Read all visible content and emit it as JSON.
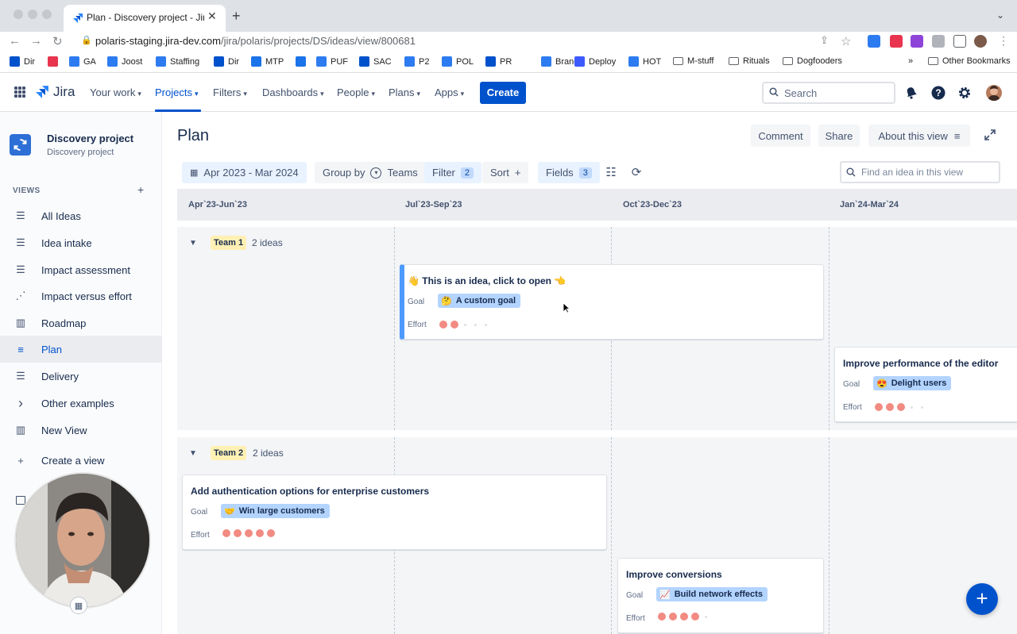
{
  "browser": {
    "tab_title": "Plan - Discovery project - Jira",
    "url_host": "polaris-staging.jira-dev.com",
    "url_path": "/jira/polaris/projects/DS/ideas/view/800681",
    "bookmarks": [
      "Dir",
      "",
      "GA",
      "Joost",
      "Staffing",
      "Dir",
      "MTP",
      "",
      "PUF",
      "SAC",
      "P2",
      "POL",
      "PR",
      "Branch",
      "Deploy",
      "HOT",
      "M-stuff",
      "Rituals",
      "Dogfooders"
    ],
    "bookmarks_more": "»",
    "other_bookmarks": "Other Bookmarks"
  },
  "topnav": {
    "logo_text": "Jira",
    "items": [
      "Your work",
      "Projects",
      "Filters",
      "Dashboards",
      "People",
      "Plans",
      "Apps"
    ],
    "create_label": "Create",
    "search_placeholder": "Search"
  },
  "sidebar": {
    "project_name": "Discovery project",
    "project_type": "Discovery project",
    "views_label": "VIEWS",
    "items": [
      {
        "label": "All Ideas",
        "icon": "list-icon"
      },
      {
        "label": "Idea intake",
        "icon": "list-icon"
      },
      {
        "label": "Impact assessment",
        "icon": "list-icon"
      },
      {
        "label": "Impact versus effort",
        "icon": "scatter-icon"
      },
      {
        "label": "Roadmap",
        "icon": "board-icon"
      },
      {
        "label": "Plan",
        "icon": "timeline-icon"
      },
      {
        "label": "Delivery",
        "icon": "list-icon"
      },
      {
        "label": "Other examples",
        "icon": "chevron-right-icon"
      },
      {
        "label": "New View",
        "icon": "board-icon"
      },
      {
        "label": "Create a view",
        "icon": "plus-icon"
      }
    ]
  },
  "main": {
    "title": "Plan",
    "header_buttons": {
      "comment": "Comment",
      "share": "Share",
      "about": "About this view"
    },
    "toolbar": {
      "date_range": "Apr 2023 - Mar 2024",
      "group_by_label": "Group by",
      "group_by_value": "Teams",
      "filter_label": "Filter",
      "filter_count": "2",
      "sort_label": "Sort",
      "sort_add": "+",
      "fields_label": "Fields",
      "fields_count": "3",
      "search_placeholder": "Find an idea in this view"
    },
    "columns": [
      "Apr`23-Jun`23",
      "Jul`23-Sep`23",
      "Oct`23-Dec`23",
      "Jan`24-Mar`24"
    ],
    "lanes": [
      {
        "tag": "Team 1",
        "count": "2 ideas",
        "cards": [
          {
            "title": "👋 This is an idea, click to open 👈",
            "goal_label": "Goal",
            "goal": "A custom goal",
            "goal_icon": "🤔",
            "effort_label": "Effort",
            "effort": 2
          },
          {
            "title": "Improve performance of the editor",
            "goal_label": "Goal",
            "goal": "Delight users",
            "goal_icon": "😍",
            "effort_label": "Effort",
            "effort": 3
          }
        ]
      },
      {
        "tag": "Team 2",
        "count": "2 ideas",
        "cards": [
          {
            "title": "Add authentication options for enterprise customers",
            "goal_label": "Goal",
            "goal": "Win large customers",
            "goal_icon": "🤝",
            "effort_label": "Effort",
            "effort": 5
          },
          {
            "title": "Improve conversions",
            "goal_label": "Goal",
            "goal": "Build network effects",
            "goal_icon": "📈",
            "effort_label": "Effort",
            "effort": 4
          }
        ]
      }
    ]
  },
  "colors": {
    "accent": "#0052cc",
    "goal_pill": "#b3d4ff",
    "effort_dot": "#f28b82",
    "team_tag": "#fff0b3"
  }
}
